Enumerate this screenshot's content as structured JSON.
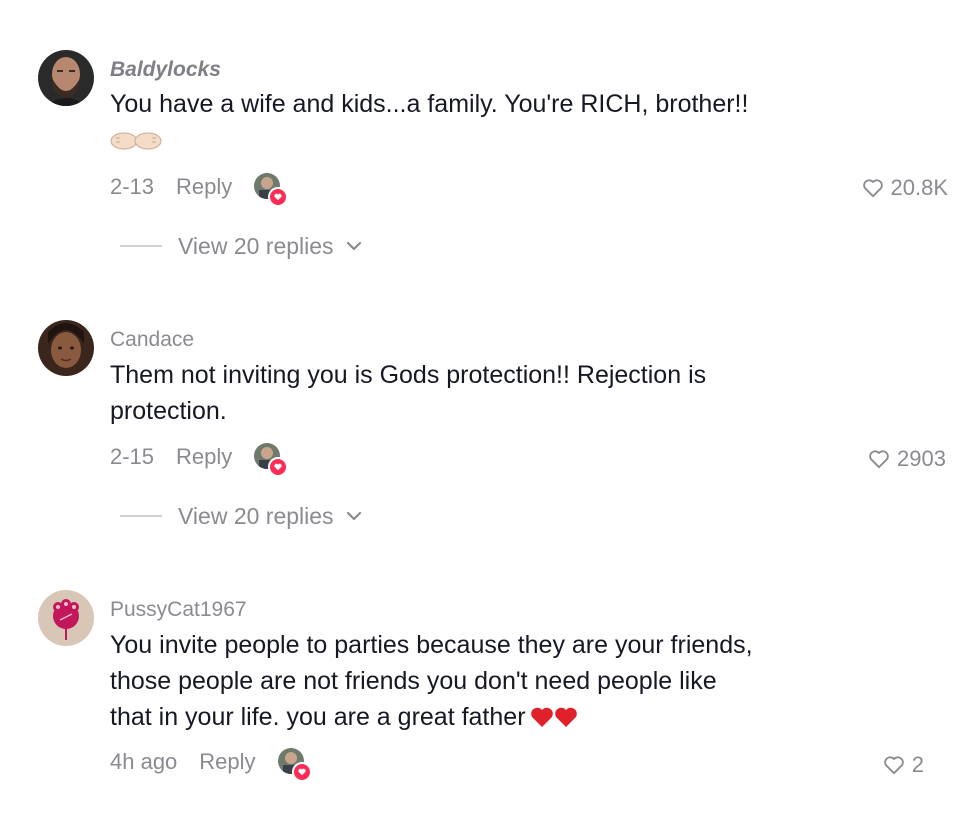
{
  "comments": [
    {
      "username": "Baldylocks",
      "text": "You have a wife and kids...a family. You're RICH, brother!!",
      "emoji": "fist-bump",
      "date": "2-13",
      "reply_label": "Reply",
      "likes": "20.8K",
      "view_replies": "View 20 replies"
    },
    {
      "username": "Candace",
      "text_line1": "Them not inviting you is Gods protection!! Rejection is",
      "text_line2": "protection.",
      "date": "2-15",
      "reply_label": "Reply",
      "likes": "2903",
      "view_replies": "View 20 replies"
    },
    {
      "username": "PussyCat1967",
      "text_line1": "You invite people to parties because they are your friends,",
      "text_line2": "those people are not friends you don't need people like",
      "text_line3": "that in your life. you are a great father",
      "emoji": "two-red-hearts",
      "date": "4h ago",
      "reply_label": "Reply",
      "likes": "2"
    }
  ],
  "colors": {
    "muted": "#8a8b91",
    "text": "#161823",
    "accent": "#fe2c55"
  }
}
